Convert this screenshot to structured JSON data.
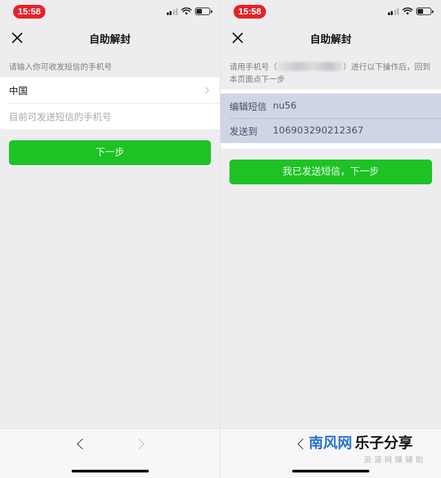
{
  "left": {
    "status": {
      "time": "15:58"
    },
    "nav": {
      "title": "自助解封"
    },
    "hint": "请输入你可收发短信的手机号",
    "country": "中国",
    "phone_placeholder": "目前可发送短信的手机号",
    "next_button": "下一步"
  },
  "right": {
    "status": {
      "time": "15:58"
    },
    "nav": {
      "title": "自助解封"
    },
    "hint_before": "请用手机号（",
    "hint_after": "）进行以下操作后，回到本页面点下一步",
    "sms": {
      "edit_label": "编辑短信",
      "edit_value": "nu56",
      "send_label": "发送到",
      "send_value": "106903290212367"
    },
    "done_button": "我已发送短信，下一步"
  },
  "watermark": {
    "part1": "南风网",
    "part2": "乐子分享",
    "sub": "资源网赚辅助"
  },
  "colors": {
    "accent": "#1dc225",
    "time_pill": "#e8212a",
    "highlight": "#cfd5e6"
  }
}
